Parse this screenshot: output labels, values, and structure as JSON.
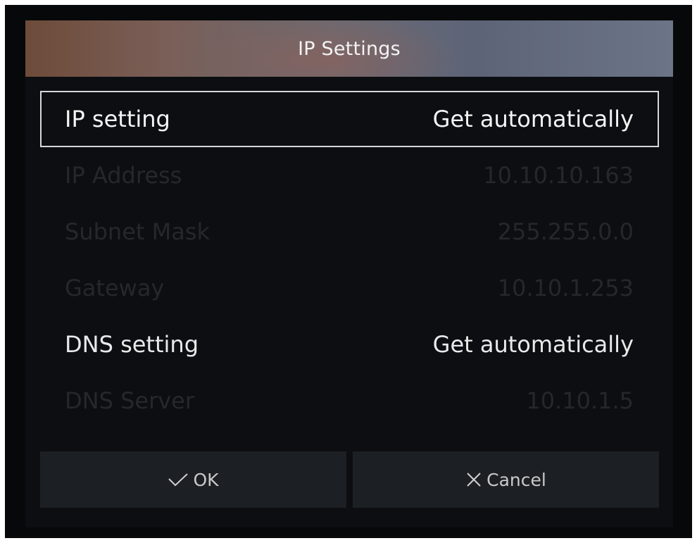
{
  "dialog": {
    "title": "IP Settings"
  },
  "rows": [
    {
      "label": "IP setting",
      "value": "Get automatically",
      "state": "focused"
    },
    {
      "label": "IP Address",
      "value": "10.10.10.163",
      "state": "dim"
    },
    {
      "label": "Subnet Mask",
      "value": "255.255.0.0",
      "state": "dim"
    },
    {
      "label": "Gateway",
      "value": "10.10.1.253",
      "state": "dim"
    },
    {
      "label": "DNS setting",
      "value": "Get automatically",
      "state": "active"
    },
    {
      "label": "DNS Server",
      "value": "10.10.1.5",
      "state": "dim"
    }
  ],
  "buttons": {
    "ok_label": "OK",
    "ok_icon": "check-icon",
    "cancel_label": "Cancel",
    "cancel_icon": "close-icon"
  },
  "colors": {
    "background": "#070809",
    "dialog_background": "#0c0e11",
    "focus_border": "#d8d8d8",
    "disabled_text": "#24282d",
    "button_background": "#1c1f23"
  }
}
